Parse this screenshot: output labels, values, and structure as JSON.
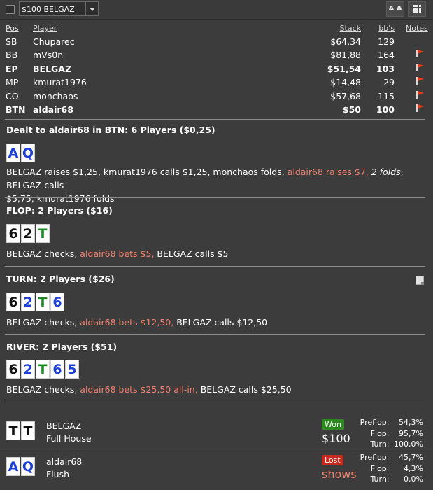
{
  "toolbar": {
    "filter_value": "$100 BELGAZ",
    "font_button_label": "A A",
    "grid_icon": "grid-icon"
  },
  "players_table": {
    "headers": {
      "pos": "Pos",
      "player": "Player",
      "stack": "Stack",
      "bbs": "bb's",
      "notes": "Notes"
    },
    "rows": [
      {
        "pos": "SB",
        "player": "Chuparec",
        "stack": "$64,34",
        "bbs": "129",
        "bold": false,
        "flag": false
      },
      {
        "pos": "BB",
        "player": "mVs0n",
        "stack": "$81,88",
        "bbs": "164",
        "bold": false,
        "flag": true
      },
      {
        "pos": "EP",
        "player": "BELGAZ",
        "stack": "$51,54",
        "bbs": "103",
        "bold": true,
        "flag": true
      },
      {
        "pos": "MP",
        "player": "kmurat1976",
        "stack": "$14,48",
        "bbs": "29",
        "bold": false,
        "flag": true
      },
      {
        "pos": "CO",
        "player": "monchaos",
        "stack": "$57,68",
        "bbs": "115",
        "bold": false,
        "flag": true
      },
      {
        "pos": "BTN",
        "player": "aldair68",
        "stack": "$50",
        "bbs": "100",
        "bold": true,
        "flag": true
      }
    ]
  },
  "preflop": {
    "title": "Dealt to aldair68 in BTN: 6 Players ($0,25)",
    "cards": [
      {
        "rank": "A",
        "suit": "diamond"
      },
      {
        "rank": "Q",
        "suit": "diamond"
      }
    ],
    "actions": {
      "a1": "BELGAZ raises $1,25, kmurat1976 calls $1,25, monchaos folds, ",
      "a2": "aldair68 raises $7,",
      "a3": " ",
      "a4": "2 folds",
      "a5": ", BELGAZ calls",
      "a6": "$5,75, kmurat1976 folds"
    }
  },
  "flop": {
    "title": "FLOP: 2 Players ($16)",
    "cards": [
      {
        "rank": "6",
        "suit": "spade"
      },
      {
        "rank": "2",
        "suit": "spade"
      },
      {
        "rank": "T",
        "suit": "club"
      }
    ],
    "actions": {
      "a1": "BELGAZ checks, ",
      "a2": "aldair68 bets $5,",
      "a3": " BELGAZ calls $5"
    }
  },
  "turn": {
    "title": "TURN: 2 Players ($26)",
    "cards": [
      {
        "rank": "6",
        "suit": "spade"
      },
      {
        "rank": "2",
        "suit": "diamond"
      },
      {
        "rank": "T",
        "suit": "club"
      },
      {
        "rank": "6",
        "suit": "diamond"
      }
    ],
    "actions": {
      "a1": "BELGAZ checks, ",
      "a2": "aldair68 bets $12,50,",
      "a3": " BELGAZ calls $12,50"
    }
  },
  "river": {
    "title": "RIVER: 2 Players ($51)",
    "cards": [
      {
        "rank": "6",
        "suit": "spade"
      },
      {
        "rank": "2",
        "suit": "diamond"
      },
      {
        "rank": "T",
        "suit": "club"
      },
      {
        "rank": "6",
        "suit": "diamond"
      },
      {
        "rank": "5",
        "suit": "diamond"
      }
    ],
    "actions": {
      "a1": "BELGAZ checks, ",
      "a2": "aldair68 bets $25,50 all-in,",
      "a3": " BELGAZ calls $25,50"
    }
  },
  "results": [
    {
      "player": "BELGAZ",
      "hand": "Full House",
      "cards": [
        {
          "rank": "T",
          "suit": "spade"
        },
        {
          "rank": "T",
          "suit": "spade"
        }
      ],
      "status": "Won",
      "amount": "$100",
      "equity": {
        "preflop_label": "Preflop:",
        "preflop": "54,3%",
        "flop_label": "Flop:",
        "flop": "95,7%",
        "turn_label": "Turn:",
        "turn": "100,0%"
      }
    },
    {
      "player": "aldair68",
      "hand": "Flush",
      "cards": [
        {
          "rank": "A",
          "suit": "diamond"
        },
        {
          "rank": "Q",
          "suit": "diamond"
        }
      ],
      "status": "Lost",
      "amount": "shows",
      "equity": {
        "preflop_label": "Preflop:",
        "preflop": "45,7%",
        "flop_label": "Flop:",
        "flop": "4,3%",
        "turn_label": "Turn:",
        "turn": "0,0%"
      }
    }
  ],
  "colors": {
    "background": "#3c3c3c",
    "hero_action": "#f08170",
    "won": "#2d8a1f",
    "lost": "#c72a1f",
    "flag": "#e8391a"
  }
}
